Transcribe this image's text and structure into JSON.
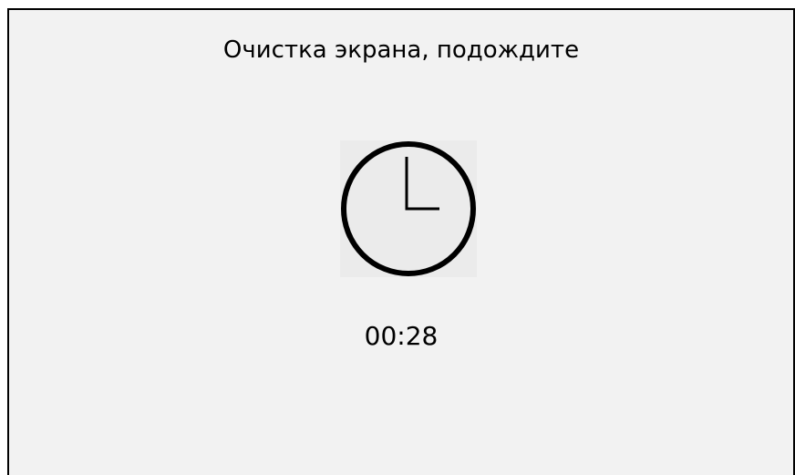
{
  "dialog": {
    "title": "Очистка экрана, подождите",
    "countdown": "00:28",
    "icon": "clock-icon",
    "colors": {
      "background": "#f2f2f2",
      "text": "#000000",
      "icon_background": "#ebebeb"
    }
  }
}
